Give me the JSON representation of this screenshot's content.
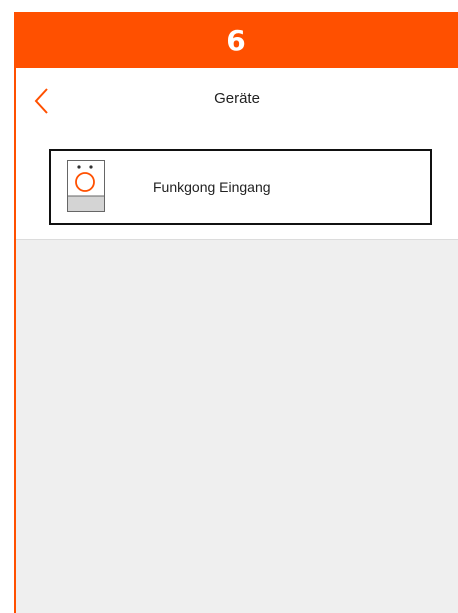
{
  "step": {
    "number": "6"
  },
  "nav": {
    "title": "Geräte",
    "back_icon": "chevron-left-icon"
  },
  "devices": [
    {
      "label": "Funkgong Eingang",
      "icon": "door-chime-icon"
    }
  ],
  "colors": {
    "accent": "#ff5000",
    "background": "#efefef",
    "divider": "#dcdcdc"
  }
}
